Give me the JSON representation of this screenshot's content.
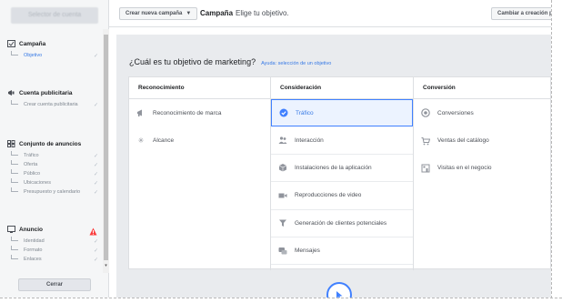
{
  "account_name": "Selector de cuenta",
  "topbar": {
    "create_label": "Crear nueva campaña",
    "title_bold": "Campaña",
    "title_sub": "Elige tu objetivo.",
    "switch_label": "Cambiar a creación p"
  },
  "sidebar": {
    "sections": [
      {
        "title": "Campaña",
        "icon": "folder-icon",
        "items": [
          {
            "label": "Objetivo",
            "active": true,
            "checked": true
          }
        ]
      },
      {
        "title": "Cuenta publicitaria",
        "icon": "megaphone-icon",
        "items": [
          {
            "label": "Crear cuenta publicitaria",
            "active": false,
            "checked": true
          }
        ]
      },
      {
        "title": "Conjunto de anuncios",
        "icon": "grid-icon",
        "items": [
          {
            "label": "Tráfico",
            "active": false,
            "checked": true
          },
          {
            "label": "Oferta",
            "active": false,
            "checked": true
          },
          {
            "label": "Público",
            "active": false,
            "checked": true
          },
          {
            "label": "Ubicaciones",
            "active": false,
            "checked": true
          },
          {
            "label": "Presupuesto y calendario",
            "active": false,
            "checked": true
          }
        ]
      },
      {
        "title": "Anuncio",
        "icon": "monitor-icon",
        "warning": true,
        "items": [
          {
            "label": "Identidad",
            "active": false,
            "checked": true
          },
          {
            "label": "Formato",
            "active": false,
            "checked": true
          },
          {
            "label": "Enlaces",
            "active": false,
            "checked": true
          }
        ]
      }
    ],
    "close_label": "Cerrar"
  },
  "main": {
    "question": "¿Cuál es tu objetivo de marketing?",
    "help_link": "Ayuda: selección de un objetivo",
    "columns": [
      {
        "header": "Reconocimiento",
        "options": [
          {
            "label": "Reconocimiento de marca",
            "icon": "megaphone-icon"
          },
          {
            "label": "Alcance",
            "icon": "snowflake-icon"
          }
        ]
      },
      {
        "header": "Consideración",
        "options": [
          {
            "label": "Tráfico",
            "icon": "check-circle-icon",
            "selected": true
          },
          {
            "label": "Interacción",
            "icon": "people-icon"
          },
          {
            "label": "Instalaciones de la aplicación",
            "icon": "box-icon"
          },
          {
            "label": "Reproducciones de video",
            "icon": "video-icon"
          },
          {
            "label": "Generación de clientes potenciales",
            "icon": "funnel-icon"
          },
          {
            "label": "Mensajes",
            "icon": "chat-icon"
          }
        ]
      },
      {
        "header": "Conversión",
        "options": [
          {
            "label": "Conversiones",
            "icon": "globe-icon"
          },
          {
            "label": "Ventas del catálogo",
            "icon": "cart-icon"
          },
          {
            "label": "Visitas en el negocio",
            "icon": "store-icon"
          }
        ]
      }
    ]
  },
  "colors": {
    "accent": "#4080ff",
    "link": "#3578e5",
    "warning": "#fa3e3e",
    "panel_bg": "#e9ebee"
  }
}
